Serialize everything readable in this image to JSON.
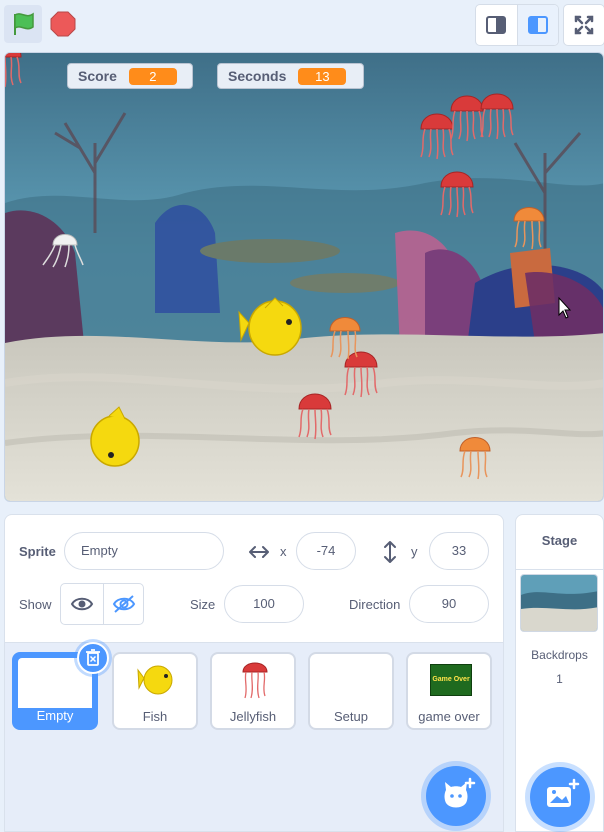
{
  "toolbar": {
    "green_flag": "green-flag-icon",
    "stop": "stop-icon",
    "small_stage": "small-stage-icon",
    "large_stage": "large-stage-icon",
    "fullscreen": "fullscreen-icon"
  },
  "monitors": [
    {
      "label": "Score",
      "value": "2"
    },
    {
      "label": "Seconds",
      "value": "13"
    }
  ],
  "sprite_info": {
    "sprite_label": "Sprite",
    "sprite_name": "Empty",
    "x_label": "x",
    "x_value": "-74",
    "y_label": "y",
    "y_value": "33",
    "show_label": "Show",
    "size_label": "Size",
    "size_value": "100",
    "direction_label": "Direction",
    "direction_value": "90"
  },
  "sprites": [
    {
      "name": "Empty",
      "selected": true
    },
    {
      "name": "Fish"
    },
    {
      "name": "Jellyfish"
    },
    {
      "name": "Setup"
    },
    {
      "name": "game over",
      "thumb_text": "Game Over"
    }
  ],
  "stage_panel": {
    "title": "Stage",
    "backdrops_label": "Backdrops",
    "backdrops_count": "1"
  },
  "colors": {
    "accent": "#4c97ff",
    "monitor_value": "#ff8c1a",
    "text": "#575e75"
  }
}
